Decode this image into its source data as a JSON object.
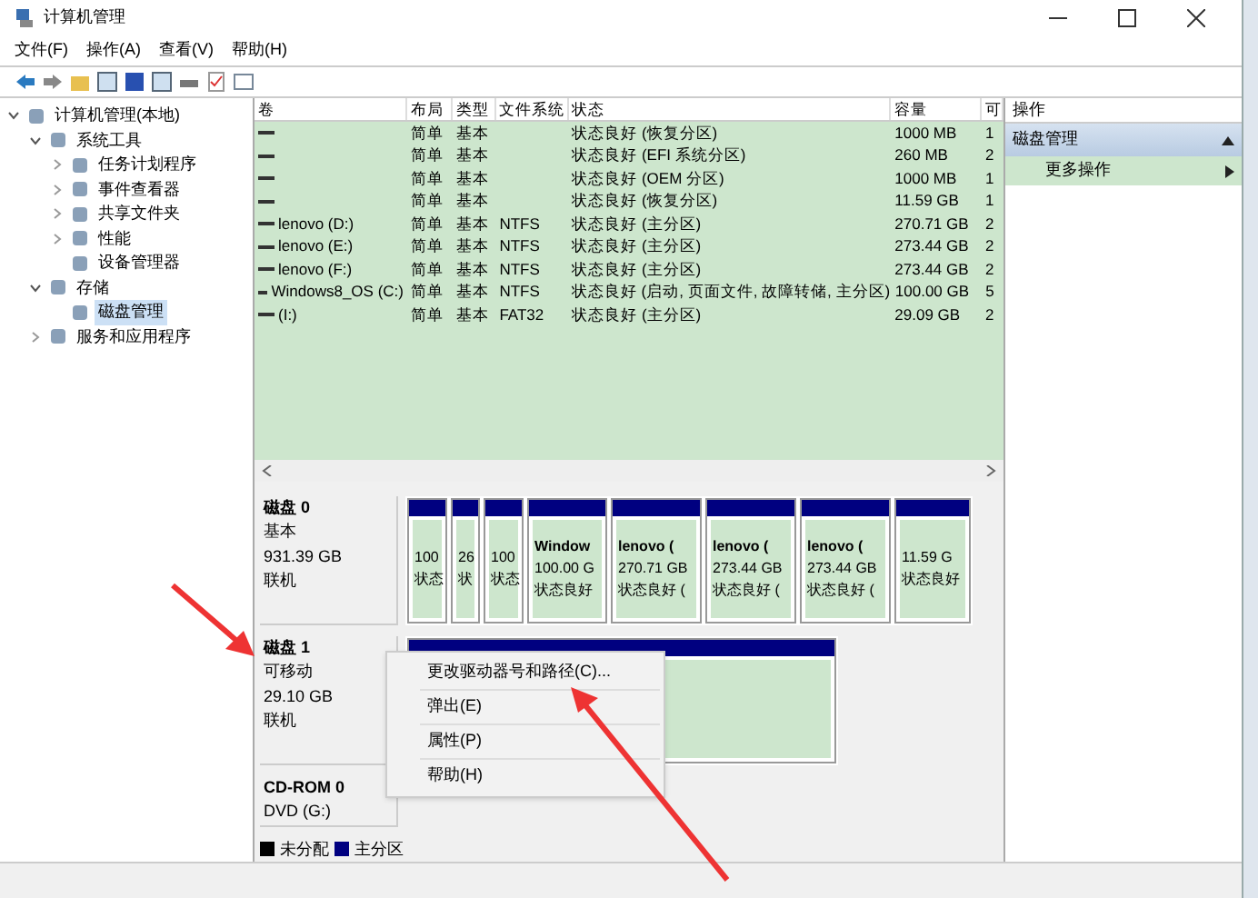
{
  "window": {
    "title": "计算机管理"
  },
  "menu": [
    "文件(F)",
    "操作(A)",
    "查看(V)",
    "帮助(H)"
  ],
  "tree": [
    {
      "label": "计算机管理(本地)",
      "expanded": true,
      "selected": false,
      "children": [
        {
          "label": "系统工具",
          "expanded": true,
          "selected": false,
          "children": [
            {
              "label": "任务计划程序",
              "expanded": false,
              "selected": false
            },
            {
              "label": "事件查看器",
              "expanded": false,
              "selected": false
            },
            {
              "label": "共享文件夹",
              "expanded": false,
              "selected": false
            },
            {
              "label": "性能",
              "expanded": false,
              "selected": false
            },
            {
              "label": "设备管理器",
              "selected": false
            }
          ]
        },
        {
          "label": "存储",
          "expanded": true,
          "selected": false,
          "children": [
            {
              "label": "磁盘管理",
              "selected": true
            }
          ]
        },
        {
          "label": "服务和应用程序",
          "expanded": false,
          "selected": false
        }
      ]
    }
  ],
  "table": {
    "columns": [
      "卷",
      "布局",
      "类型",
      "文件系统",
      "状态",
      "容量",
      "可"
    ],
    "rows": [
      [
        "",
        "简单",
        "基本",
        "",
        "状态良好 (恢复分区)",
        "1000 MB",
        "1"
      ],
      [
        "",
        "简单",
        "基本",
        "",
        "状态良好 (EFI 系统分区)",
        "260 MB",
        "2"
      ],
      [
        "",
        "简单",
        "基本",
        "",
        "状态良好 (OEM 分区)",
        "1000 MB",
        "1"
      ],
      [
        "",
        "简单",
        "基本",
        "",
        "状态良好 (恢复分区)",
        "11.59 GB",
        "1"
      ],
      [
        "lenovo (D:)",
        "简单",
        "基本",
        "NTFS",
        "状态良好 (主分区)",
        "270.71 GB",
        "2"
      ],
      [
        "lenovo (E:)",
        "简单",
        "基本",
        "NTFS",
        "状态良好 (主分区)",
        "273.44 GB",
        "2"
      ],
      [
        "lenovo (F:)",
        "简单",
        "基本",
        "NTFS",
        "状态良好 (主分区)",
        "273.44 GB",
        "2"
      ],
      [
        "Windows8_OS (C:)",
        "简单",
        "基本",
        "NTFS",
        "状态良好 (启动, 页面文件, 故障转储, 主分区)",
        "100.00 GB",
        "5"
      ],
      [
        "(I:)",
        "简单",
        "基本",
        "FAT32",
        "状态良好 (主分区)",
        "29.09 GB",
        "2"
      ]
    ]
  },
  "disks": [
    {
      "name": "磁盘 0",
      "lines": [
        "基本",
        "931.39 GB",
        "联机"
      ],
      "partitions": [
        {
          "kind": "primary",
          "lines": [
            "100",
            "状态"
          ]
        },
        {
          "kind": "primary",
          "lines": [
            "26",
            "状"
          ]
        },
        {
          "kind": "primary",
          "lines": [
            "100",
            "状态"
          ]
        },
        {
          "kind": "primary",
          "lines": [
            "Window",
            "100.00 G",
            "状态良好"
          ]
        },
        {
          "kind": "primary",
          "lines": [
            "lenovo (",
            "270.71 GB",
            "状态良好 ("
          ]
        },
        {
          "kind": "primary",
          "lines": [
            "lenovo (",
            "273.44 GB",
            "状态良好 ("
          ]
        },
        {
          "kind": "primary",
          "lines": [
            "lenovo (",
            "273.44 GB",
            "状态良好 ("
          ]
        },
        {
          "kind": "primary",
          "lines": [
            "11.59 G",
            "状态良好"
          ]
        }
      ]
    },
    {
      "name": "磁盘 1",
      "lines": [
        "可移动",
        "29.10 GB",
        "联机"
      ],
      "partitions": [
        {
          "kind": "primary"
        }
      ]
    },
    {
      "name": "CD-ROM 0",
      "lines": [
        "DVD (G:)"
      ]
    }
  ],
  "legend": [
    {
      "label": "未分配",
      "color": "#000000"
    },
    {
      "label": "主分区",
      "color": "#000080"
    }
  ],
  "context_menu": [
    "更改驱动器号和路径(C)...",
    "弹出(E)",
    "属性(P)",
    "帮助(H)"
  ],
  "actions": {
    "title": "操作",
    "section": "磁盘管理",
    "items": [
      "更多操作"
    ]
  }
}
